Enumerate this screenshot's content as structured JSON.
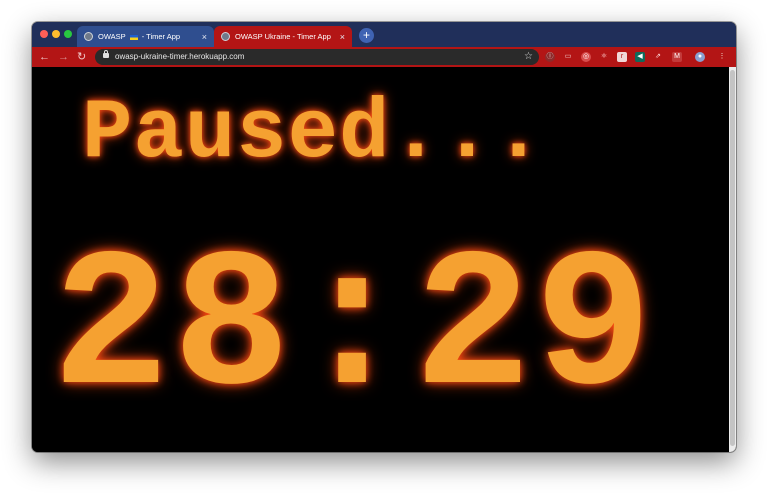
{
  "tabs": [
    {
      "title_pre": "OWASP",
      "title_post": "- Timer App",
      "close": "×"
    },
    {
      "title": "OWASP Ukraine - Timer App",
      "close": "×"
    }
  ],
  "new_tab": "+",
  "toolbar": {
    "back": "←",
    "forward": "→",
    "reload": "↻",
    "star": "☆"
  },
  "address_bar": {
    "url": "owasp-ukraine-timer.herokuapp.com"
  },
  "extensions": [
    "Ⓘ",
    "▭",
    "◎",
    "⚛",
    "r",
    "◀",
    "⇗",
    "M",
    "●",
    "⋮"
  ],
  "page": {
    "status_text": "Paused...",
    "timer_display": "28:29"
  },
  "colors": {
    "tab_strip": "#202f5a",
    "active_tab": "#b31515",
    "toolbar": "#b31515",
    "timer_text": "#f5a131",
    "glow": "#ff4a12"
  }
}
